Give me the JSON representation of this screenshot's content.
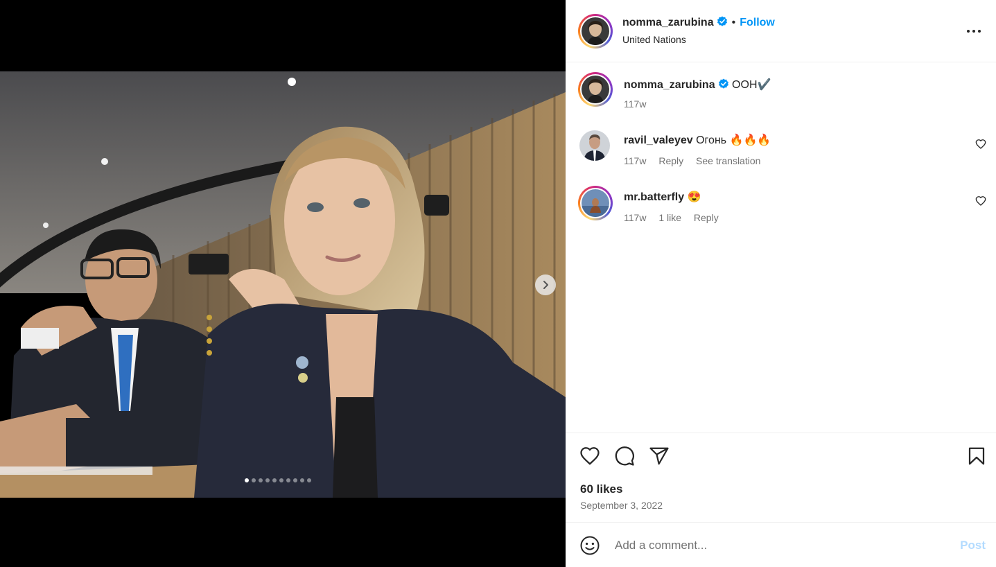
{
  "post": {
    "author": "nomma_zarubina",
    "follow_label": "Follow",
    "separator": "•",
    "location": "United Nations",
    "media_description_icon": "photo-carousel",
    "carousel": {
      "total_slides": 10,
      "current_slide": 1
    }
  },
  "caption": {
    "username": "nomma_zarubina",
    "text": "ООН✔️",
    "time": "117w"
  },
  "comments": [
    {
      "username": "ravil_valeyev",
      "text": "Огонь 🔥🔥🔥",
      "time": "117w",
      "reply_label": "Reply",
      "translate_label": "See translation"
    },
    {
      "username": "mr.batterfly",
      "text": "😍",
      "time": "117w",
      "likes_label": "1 like",
      "reply_label": "Reply"
    }
  ],
  "engagement": {
    "likes_text": "60 likes",
    "date_text": "September 3, 2022"
  },
  "composer": {
    "placeholder": "Add a comment...",
    "post_label": "Post"
  },
  "colors": {
    "link_blue": "#0095f6",
    "post_disabled": "#b3dbff",
    "muted_text": "#737373",
    "verified_blue": "#0095f6"
  },
  "icons": [
    "verified-badge-icon",
    "more-options-icon",
    "heart-icon",
    "comment-icon",
    "share-icon",
    "bookmark-icon",
    "emoji-icon",
    "chevron-right-icon"
  ]
}
